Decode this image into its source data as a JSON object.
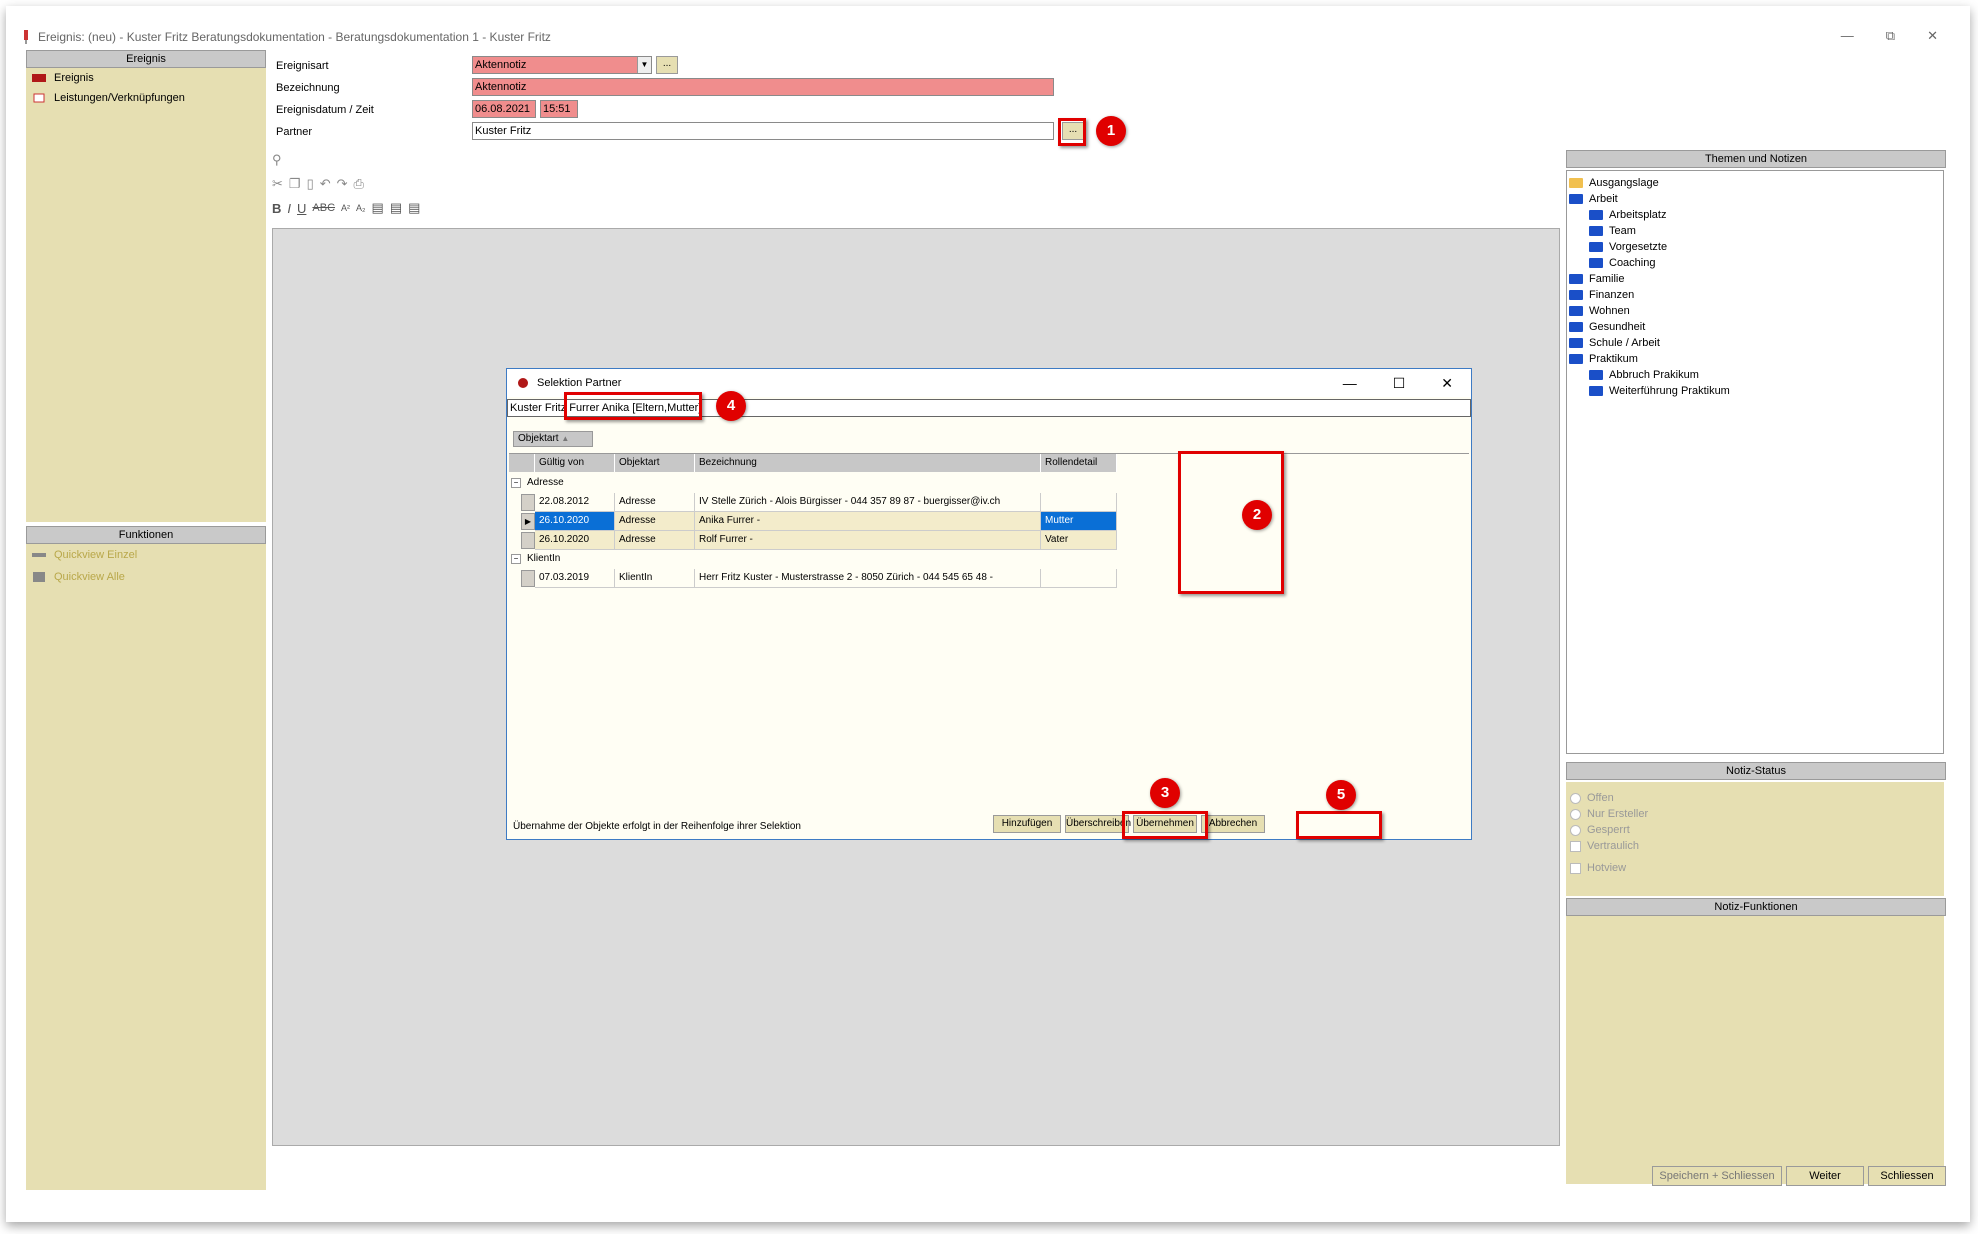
{
  "window": {
    "title": "Ereignis: (neu) - Kuster Fritz Beratungsdokumentation - Beratungsdokumentation 1 - Kuster Fritz"
  },
  "left": {
    "header": "Ereignis",
    "items": [
      {
        "label": "Ereignis"
      },
      {
        "label": "Leistungen/Verknüpfungen"
      }
    ],
    "functions_header": "Funktionen",
    "functions": [
      {
        "label": "Quickview Einzel"
      },
      {
        "label": "Quickview Alle"
      }
    ]
  },
  "form": {
    "ereignisart_label": "Ereignisart",
    "ereignisart_value": "Aktennotiz",
    "bezeichnung_label": "Bezeichnung",
    "bezeichnung_value": "Aktennotiz",
    "datum_label": "Ereignisdatum / Zeit",
    "datum_value": "06.08.2021",
    "zeit_value": "15:51",
    "partner_label": "Partner",
    "partner_value": "Kuster Fritz",
    "ellipsis": "..."
  },
  "right": {
    "themen_header": "Themen und Notizen",
    "tree": [
      {
        "label": "Ausgangslage",
        "level": 0,
        "open": true
      },
      {
        "label": "Arbeit",
        "level": 0
      },
      {
        "label": "Arbeitsplatz",
        "level": 1
      },
      {
        "label": "Team",
        "level": 1
      },
      {
        "label": "Vorgesetzte",
        "level": 1
      },
      {
        "label": "Coaching",
        "level": 1
      },
      {
        "label": "Familie",
        "level": 0
      },
      {
        "label": "Finanzen",
        "level": 0
      },
      {
        "label": "Wohnen",
        "level": 0
      },
      {
        "label": "Gesundheit",
        "level": 0
      },
      {
        "label": "Schule / Arbeit",
        "level": 0
      },
      {
        "label": "Praktikum",
        "level": 0
      },
      {
        "label": "Abbruch Prakikum",
        "level": 1
      },
      {
        "label": "Weiterführung Praktikum",
        "level": 1
      }
    ],
    "status_header": "Notiz-Status",
    "status_options": [
      "Offen",
      "Nur Ersteller",
      "Gesperrt",
      "Vertraulich"
    ],
    "hotview": "Hotview",
    "functions_header": "Notiz-Funktionen"
  },
  "bottom": {
    "save_close": "Speichern + Schliessen",
    "next": "Weiter",
    "close": "Schliessen"
  },
  "dialog": {
    "title": "Selektion Partner",
    "selection_prefix": "Kuster Fritz",
    "selection_item": "Furrer Anika [Eltern,Mutter]",
    "group_by": "Objektart",
    "columns": {
      "gueltig": "Gültig von",
      "objektart": "Objektart",
      "bezeichnung": "Bezeichnung",
      "rollendetail": "Rollendetail"
    },
    "groups": [
      {
        "name": "Adresse",
        "rows": [
          {
            "gueltig": "22.08.2012",
            "objektart": "Adresse",
            "bezeichnung": "IV Stelle Zürich -  Alois Bürgisser -  044 357 89 87 -  buergisser@iv.ch",
            "rolle": ""
          },
          {
            "gueltig": "26.10.2020",
            "objektart": "Adresse",
            "bezeichnung": "Anika Furrer -",
            "rolle": "Mutter",
            "selected": true
          },
          {
            "gueltig": "26.10.2020",
            "objektart": "Adresse",
            "bezeichnung": "Rolf Furrer -",
            "rolle": "Vater"
          }
        ]
      },
      {
        "name": "KlientIn",
        "rows": [
          {
            "gueltig": "07.03.2019",
            "objektart": "KlientIn",
            "bezeichnung": "Herr Fritz Kuster -  Musterstrasse 2 -  8050 Zürich -  044 545 65 48 -",
            "rolle": ""
          }
        ]
      }
    ],
    "footer_note": "Übernahme der Objekte erfolgt in der Reihenfolge ihrer Selektion",
    "buttons": {
      "add": "Hinzufügen",
      "overwrite": "Überschreiben",
      "apply": "Übernehmen",
      "cancel": "Abbrechen"
    }
  },
  "badges": [
    "1",
    "2",
    "3",
    "4",
    "5"
  ]
}
